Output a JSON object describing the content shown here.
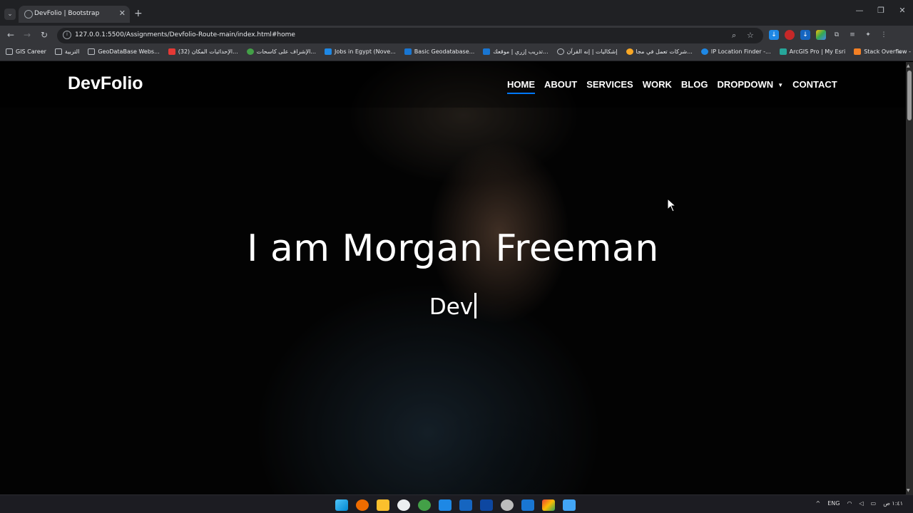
{
  "browser": {
    "tab_title": "DevFolio | Bootstrap",
    "url": "127.0.0.1:5500/Assignments/Devfolio-Route-main/index.html#home",
    "bookmarks": [
      "GIS Career",
      "التربية",
      "GeoDataBase Webs...",
      "(32) الإحداثيات المكان...",
      "الإشراف على كاسحات...",
      "Jobs in Egypt (Nove...",
      "Basic Geodatabase...",
      "تدريب إزري | موقعك...",
      "إشكاليات | إنه القرآن",
      "شركات تعمل في مجا...",
      "IP Location Finder -...",
      "ArcGIS Pro | My Esri",
      "Stack Overflow - W..."
    ]
  },
  "site": {
    "brand": "DevFolio",
    "menu": [
      "HOME",
      "ABOUT",
      "SERVICES",
      "WORK",
      "BLOG",
      "DROPDOWN",
      "CONTACT"
    ],
    "active_item": "HOME"
  },
  "hero": {
    "title": "I am Morgan Freeman",
    "typed": "Dev"
  },
  "taskbar": {
    "language": "ENG",
    "clock": "١:٤١ ص"
  },
  "colors": {
    "accent": "#0078ff",
    "chrome_dark": "#202124",
    "chrome_toolbar": "#35363a"
  }
}
